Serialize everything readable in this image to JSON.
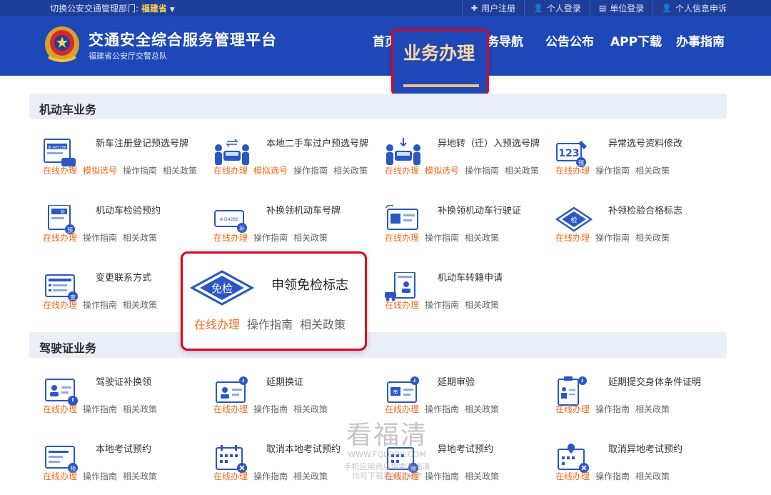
{
  "topbar": {
    "dept_label": "切换公安交通管理部门:",
    "dept_value": "福建省",
    "links": [
      "用户注册",
      "个人登录",
      "单位登录",
      "个人信息申诉"
    ]
  },
  "header": {
    "title": "交通安全综合服务管理平台",
    "subtitle": "福建省公安厅交警总队",
    "nav": {
      "home": "首页",
      "active": "业务办理",
      "service": "务导航",
      "notice": "公告公布",
      "app": "APP下载",
      "guide": "办事指南"
    }
  },
  "sections": {
    "vehicle": "机动车业务",
    "license": "驾驶证业务"
  },
  "actions": {
    "online": "在线办理",
    "guide": "操作指南",
    "policy": "相关政策",
    "plate": "模拟选号"
  },
  "vehicle_items": [
    {
      "name": "新车注册登记预选号牌",
      "plate": true
    },
    {
      "name": "本地二手车过户预选号牌",
      "plate": true
    },
    {
      "name": "异地转（迁）入预选号牌",
      "plate": true
    },
    {
      "name": "异常选号资料修改",
      "plate": false
    },
    {
      "name": "机动车检验预约",
      "plate": false
    },
    {
      "name": "补换领机动车号牌",
      "plate": false
    },
    {
      "name": "补换领机动车行驶证",
      "plate": false
    },
    {
      "name": "补领检验合格标志",
      "plate": false
    },
    {
      "name": "变更联系方式",
      "plate": false
    },
    {
      "name": "机动车转籍申请",
      "plate": false
    }
  ],
  "callout": {
    "name": "申领免检标志",
    "icon_text": "免检"
  },
  "license_items": [
    {
      "name": "驾驶证补换领"
    },
    {
      "name": "延期换证"
    },
    {
      "name": "延期审验"
    },
    {
      "name": "延期提交身体条件证明"
    },
    {
      "name": "本地考试预约"
    },
    {
      "name": "取消本地考试预约"
    },
    {
      "name": "异地考试预约"
    },
    {
      "name": "取消异地考试预约"
    }
  ],
  "icon_texts": {
    "pre": "预",
    "change": "变",
    "check": "检",
    "plate_no": "A·D4285",
    "plate_123": "123",
    "supp": "补",
    "audit": "审",
    "pre_plate": "京·A05288"
  },
  "watermark": {
    "big": "看福清",
    "url": "WWW.FQLOOK.COM",
    "line1": "手机应用商店搜索看福清",
    "line2": "均可下载看福清APP"
  },
  "colors": {
    "header_blue": "#1e48b8",
    "accent_orange": "#f26a1b",
    "highlight_red": "#e1001f"
  }
}
